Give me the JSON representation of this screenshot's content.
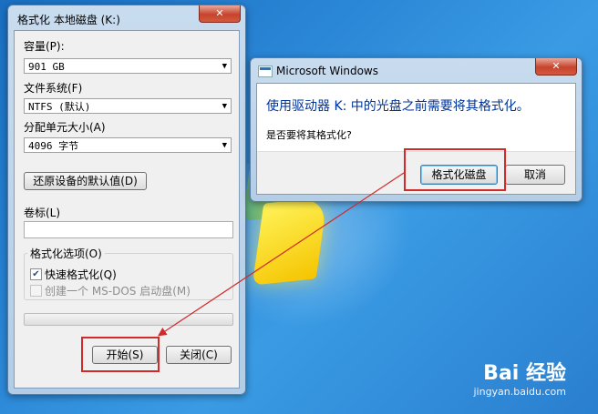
{
  "format_dialog": {
    "title": "格式化 本地磁盘 (K:)",
    "close_glyph": "✕",
    "capacity_label": "容量(P):",
    "capacity_value": "901 GB",
    "filesystem_label": "文件系统(F)",
    "filesystem_value": "NTFS (默认)",
    "allocation_label": "分配单元大小(A)",
    "allocation_value": "4096 字节",
    "restore_defaults_label": "还原设备的默认值(D)",
    "volume_label_label": "卷标(L)",
    "volume_label_value": "",
    "format_options_label": "格式化选项(O)",
    "quick_format_label": "快速格式化(Q)",
    "quick_format_checked": true,
    "msdos_label": "创建一个 MS-DOS 启动盘(M)",
    "msdos_checked": false,
    "progress": 0,
    "start_label": "开始(S)",
    "close_label": "关闭(C)"
  },
  "message_box": {
    "title": "Microsoft Windows",
    "close_glyph": "✕",
    "instruction": "使用驱动器 K: 中的光盘之前需要将其格式化。",
    "question": "是否要将其格式化?",
    "format_disk_label": "格式化磁盘",
    "cancel_label": "取消"
  },
  "watermark": {
    "brand": "Bai 经验",
    "url": "jingyan.baidu.com"
  },
  "colors": {
    "annotation": "#d12a2a",
    "instruction_text": "#003399"
  }
}
